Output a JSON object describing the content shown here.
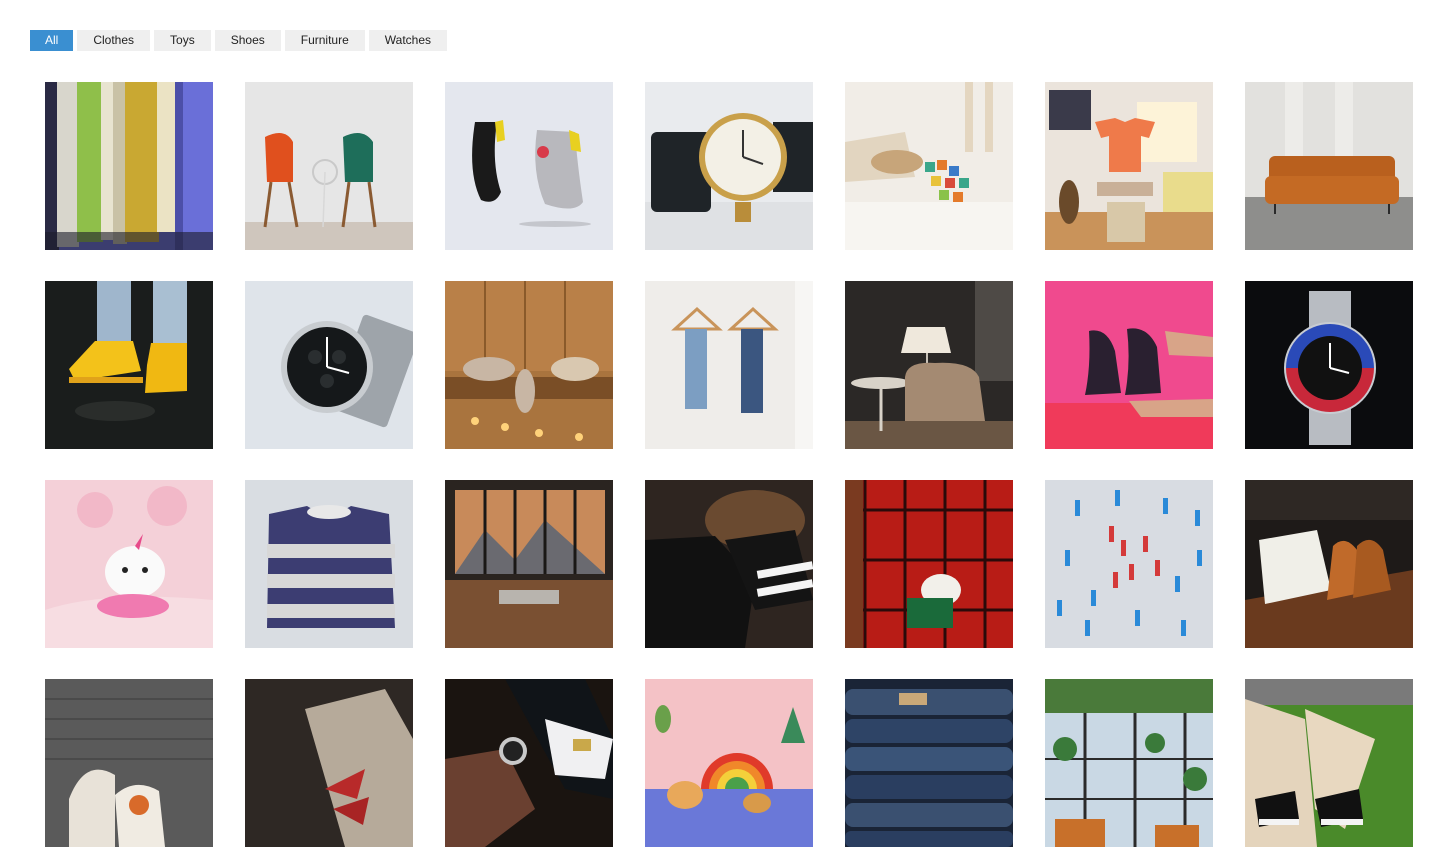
{
  "filters": [
    {
      "label": "All",
      "active": true
    },
    {
      "label": "Clothes",
      "active": false
    },
    {
      "label": "Toys",
      "active": false
    },
    {
      "label": "Shoes",
      "active": false
    },
    {
      "label": "Furniture",
      "active": false
    },
    {
      "label": "Watches",
      "active": false
    }
  ],
  "gallery": [
    {
      "category": "Clothes",
      "subject": "hanging-shirts"
    },
    {
      "category": "Furniture",
      "subject": "orange-green-chairs"
    },
    {
      "category": "Shoes",
      "subject": "floating-sneakers"
    },
    {
      "category": "Watches",
      "subject": "gold-wristwatch"
    },
    {
      "category": "Toys",
      "subject": "wooden-blocks-room"
    },
    {
      "category": "Clothes",
      "subject": "orange-tshirt-room"
    },
    {
      "category": "Furniture",
      "subject": "orange-sofa"
    },
    {
      "category": "Shoes",
      "subject": "yellow-boots"
    },
    {
      "category": "Watches",
      "subject": "chronograph-watch"
    },
    {
      "category": "Toys",
      "subject": "plush-toys-shelf"
    },
    {
      "category": "Clothes",
      "subject": "jeans-on-hangers"
    },
    {
      "category": "Furniture",
      "subject": "armchair-lamp"
    },
    {
      "category": "Shoes",
      "subject": "black-sandals-pink"
    },
    {
      "category": "Watches",
      "subject": "steel-diver-watch"
    },
    {
      "category": "Toys",
      "subject": "pink-plush-unicorn"
    },
    {
      "category": "Clothes",
      "subject": "striped-sweater"
    },
    {
      "category": "Furniture",
      "subject": "window-mountain-room"
    },
    {
      "category": "Shoes",
      "subject": "black-sneakers-feet"
    },
    {
      "category": "Clothes",
      "subject": "red-plaid-dress"
    },
    {
      "category": "Toys",
      "subject": "toy-soldiers"
    },
    {
      "category": "Shoes",
      "subject": "brown-leather-shoes"
    },
    {
      "category": "Shoes",
      "subject": "white-sneakers-dark"
    },
    {
      "category": "Shoes",
      "subject": "sneakers-shadow"
    },
    {
      "category": "Watches",
      "subject": "watch-on-wrist"
    },
    {
      "category": "Toys",
      "subject": "wooden-rainbow-toys"
    },
    {
      "category": "Clothes",
      "subject": "stacked-jeans"
    },
    {
      "category": "Furniture",
      "subject": "cafe-plants"
    },
    {
      "category": "Shoes",
      "subject": "sneakers-grass"
    }
  ]
}
